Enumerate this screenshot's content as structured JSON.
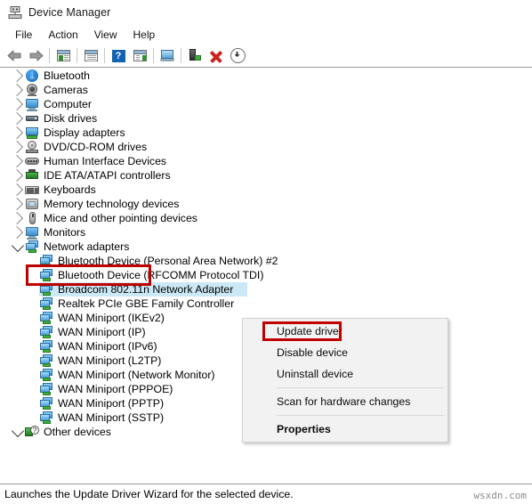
{
  "window": {
    "title": "Device Manager",
    "app_icon": "device-manager-icon"
  },
  "menubar": {
    "items": [
      {
        "label": "File"
      },
      {
        "label": "Action"
      },
      {
        "label": "View"
      },
      {
        "label": "Help"
      }
    ]
  },
  "toolbar": {
    "buttons": [
      {
        "name": "back-button",
        "icon": "back-arrow-icon"
      },
      {
        "name": "forward-button",
        "icon": "forward-arrow-icon"
      },
      {
        "name": "show-hide-console-tree-button",
        "icon": "console-tree-icon"
      },
      {
        "name": "properties-button",
        "icon": "properties-window-icon"
      },
      {
        "name": "help-button",
        "icon": "help-question-icon"
      },
      {
        "name": "show-hide-action-pane-button",
        "icon": "action-pane-icon"
      },
      {
        "name": "scan-for-hardware-changes-button",
        "icon": "monitor-scan-icon"
      },
      {
        "name": "update-driver-button",
        "icon": "driver-plug-icon"
      },
      {
        "name": "uninstall-device-button",
        "icon": "red-x-icon"
      },
      {
        "name": "disable-device-button",
        "icon": "down-arrow-circle-icon"
      }
    ]
  },
  "tree": {
    "items": [
      {
        "label": "Bluetooth",
        "icon": "bluetooth-icon",
        "level": 0,
        "expanded": false,
        "selected": false
      },
      {
        "label": "Cameras",
        "icon": "camera-icon",
        "level": 0,
        "expanded": false,
        "selected": false
      },
      {
        "label": "Computer",
        "icon": "computer-icon",
        "level": 0,
        "expanded": false,
        "selected": false
      },
      {
        "label": "Disk drives",
        "icon": "disk-drive-icon",
        "level": 0,
        "expanded": false,
        "selected": false
      },
      {
        "label": "Display adapters",
        "icon": "display-adapter-icon",
        "level": 0,
        "expanded": false,
        "selected": false
      },
      {
        "label": "DVD/CD-ROM drives",
        "icon": "dvd-drive-icon",
        "level": 0,
        "expanded": false,
        "selected": false
      },
      {
        "label": "Human Interface Devices",
        "icon": "hid-icon",
        "level": 0,
        "expanded": false,
        "selected": false
      },
      {
        "label": "IDE ATA/ATAPI controllers",
        "icon": "ide-controller-icon",
        "level": 0,
        "expanded": false,
        "selected": false
      },
      {
        "label": "Keyboards",
        "icon": "keyboard-icon",
        "level": 0,
        "expanded": false,
        "selected": false
      },
      {
        "label": "Memory technology devices",
        "icon": "memory-device-icon",
        "level": 0,
        "expanded": false,
        "selected": false
      },
      {
        "label": "Mice and other pointing devices",
        "icon": "mouse-icon",
        "level": 0,
        "expanded": false,
        "selected": false
      },
      {
        "label": "Monitors",
        "icon": "monitor-icon",
        "level": 0,
        "expanded": false,
        "selected": false
      },
      {
        "label": "Network adapters",
        "icon": "network-adapter-icon",
        "level": 0,
        "expanded": true,
        "selected": false
      },
      {
        "label": "Bluetooth Device (Personal Area Network) #2",
        "icon": "network-adapter-icon",
        "level": 1,
        "expanded": null,
        "selected": false
      },
      {
        "label": "Bluetooth Device (RFCOMM Protocol TDI)",
        "icon": "network-adapter-icon",
        "level": 1,
        "expanded": null,
        "selected": false
      },
      {
        "label": "Broadcom 802.11n Network Adapter",
        "icon": "network-adapter-icon",
        "level": 1,
        "expanded": null,
        "selected": true
      },
      {
        "label": "Realtek PCIe GBE Family Controller",
        "icon": "network-adapter-icon",
        "level": 1,
        "expanded": null,
        "selected": false
      },
      {
        "label": "WAN Miniport (IKEv2)",
        "icon": "network-adapter-icon",
        "level": 1,
        "expanded": null,
        "selected": false
      },
      {
        "label": "WAN Miniport (IP)",
        "icon": "network-adapter-icon",
        "level": 1,
        "expanded": null,
        "selected": false
      },
      {
        "label": "WAN Miniport (IPv6)",
        "icon": "network-adapter-icon",
        "level": 1,
        "expanded": null,
        "selected": false
      },
      {
        "label": "WAN Miniport (L2TP)",
        "icon": "network-adapter-icon",
        "level": 1,
        "expanded": null,
        "selected": false
      },
      {
        "label": "WAN Miniport (Network Monitor)",
        "icon": "network-adapter-icon",
        "level": 1,
        "expanded": null,
        "selected": false
      },
      {
        "label": "WAN Miniport (PPPOE)",
        "icon": "network-adapter-icon",
        "level": 1,
        "expanded": null,
        "selected": false
      },
      {
        "label": "WAN Miniport (PPTP)",
        "icon": "network-adapter-icon",
        "level": 1,
        "expanded": null,
        "selected": false
      },
      {
        "label": "WAN Miniport (SSTP)",
        "icon": "network-adapter-icon",
        "level": 1,
        "expanded": null,
        "selected": false
      },
      {
        "label": "Other devices",
        "icon": "other-devices-warning-icon",
        "level": 0,
        "expanded": true,
        "selected": false
      }
    ]
  },
  "context_menu": {
    "items": [
      {
        "label": "Update driver",
        "bold": false,
        "separator_after": false
      },
      {
        "label": "Disable device",
        "bold": false,
        "separator_after": false
      },
      {
        "label": "Uninstall device",
        "bold": false,
        "separator_after": true
      },
      {
        "label": "Scan for hardware changes",
        "bold": false,
        "separator_after": true
      },
      {
        "label": "Properties",
        "bold": true,
        "separator_after": false
      }
    ]
  },
  "annotations": [
    {
      "name": "network-adapters-highlight",
      "target": "Network adapters",
      "color": "#c00000"
    },
    {
      "name": "update-driver-highlight",
      "target": "Update driver",
      "color": "#c00000"
    }
  ],
  "statusbar": {
    "text": "Launches the Update Driver Wizard for the selected device."
  },
  "watermark": {
    "text": "wsxdn.com"
  },
  "colors": {
    "selection": "#cbe8f6",
    "annotation": "#c00000",
    "menu_bg": "#f2f2f2",
    "border": "#9a9a9a"
  }
}
